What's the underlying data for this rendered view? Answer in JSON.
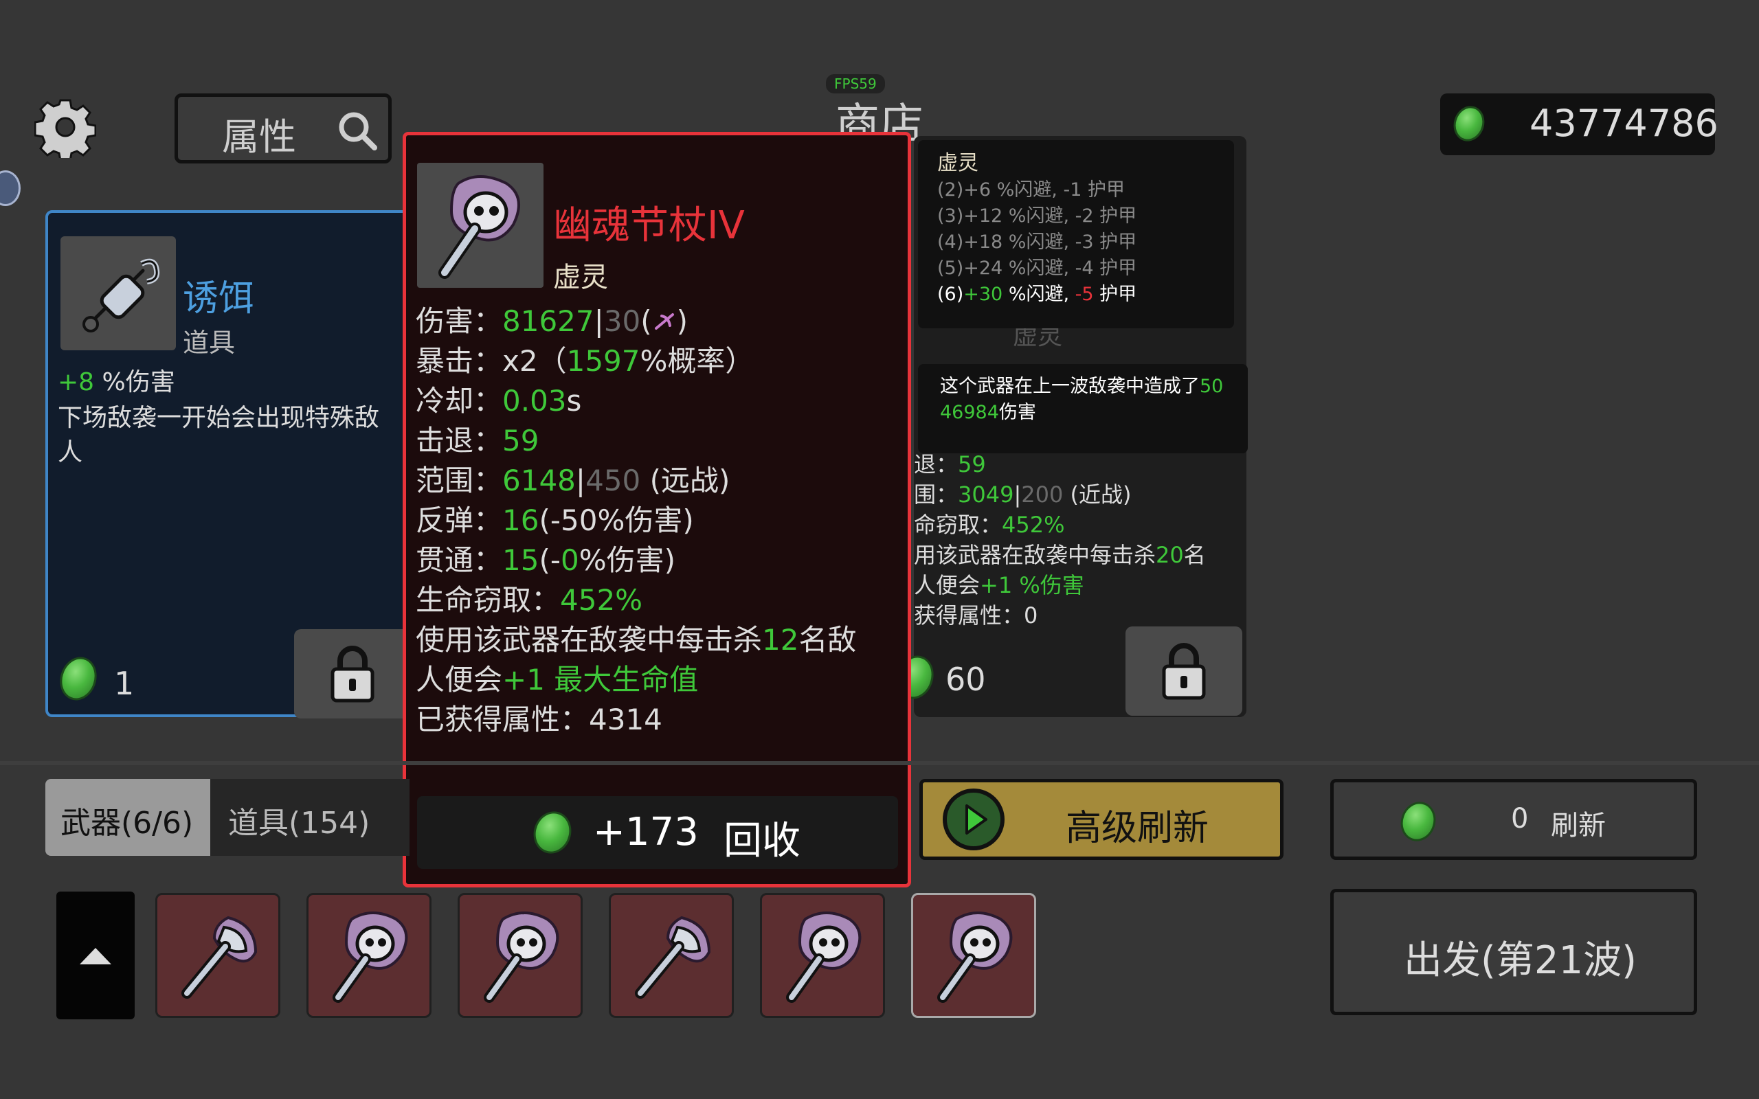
{
  "fps": "FPS59",
  "shop_title": "商店",
  "money": "43774786",
  "attr_button": "属性",
  "left_card": {
    "name": "诱饵",
    "type": "道具",
    "stat_value": "+8",
    "stat_label": "%伤害",
    "desc": "下场敌袭一开始会出现特殊敌人",
    "price": "1"
  },
  "tooltip": {
    "name": "幽魂节杖IV",
    "type": "虚灵",
    "damage_label": "伤害：",
    "damage_value": "81627",
    "damage_base": "30",
    "crit_label": "暴击：",
    "crit_mult": "x2（",
    "crit_value": "1597",
    "crit_suffix": "%概率）",
    "cooldown_label": "冷却：",
    "cooldown_value": "0.03",
    "cooldown_unit": "s",
    "knockback_label": "击退：",
    "knockback_value": "59",
    "range_label": "范围：",
    "range_value": "6148",
    "range_base": "450",
    "range_type": "(远战)",
    "bounce_label": "反弹：",
    "bounce_value": "16",
    "bounce_suffix": "(-50%伤害)",
    "pierce_label": "贯通：",
    "pierce_value": "15",
    "pierce_mid": "(-",
    "pierce_pct": "0",
    "pierce_suffix": "%伤害)",
    "lifesteal_label": "生命窃取：",
    "lifesteal_value": "452%",
    "kill_prefix": "使用该武器在敌袭中每击杀",
    "kill_count": "12",
    "kill_suffix": "名敌",
    "kill_line2_prefix": "人便会",
    "kill_bonus": "+1 最大生命值",
    "gained_label": "已获得属性：",
    "gained_value": "4314",
    "recycle_value": "+173",
    "recycle_label": "回收"
  },
  "set_tooltip": {
    "title": "虚灵",
    "lines": [
      "(2)+6 %闪避, -1 护甲",
      "(3)+12 %闪避, -2 护甲",
      "(4)+18 %闪避, -3 护甲",
      "(5)+24 %闪避, -4 护甲"
    ],
    "active_prefix": "(6)",
    "active_value": "+30",
    "active_mid": "%闪避, ",
    "active_neg": "-5",
    "active_suffix": "护甲"
  },
  "damage_note": {
    "prefix": "这个武器在上一波敌袭中造成了",
    "value_a": "50",
    "value_b": "46984",
    "suffix": "伤害"
  },
  "right_card": {
    "hidden_type": "虚灵",
    "knockback_label": "退：",
    "knockback_value": "59",
    "range_label": "围：",
    "range_value": "3049",
    "range_base": "200",
    "range_type": "(近战)",
    "lifesteal_label": "命窃取：",
    "lifesteal_value": "452%",
    "kill_prefix": "用该武器在敌袭中每击杀",
    "kill_count": "20",
    "kill_suffix": "名",
    "kill_line2": "人便会",
    "kill_bonus": "+1 %伤害",
    "gained_label": "获得属性：",
    "gained_value": "0",
    "price": "60"
  },
  "tabs": {
    "weapons": "武器(6/6)",
    "items": "道具(154)"
  },
  "premium_refresh": "高级刷新",
  "refresh": {
    "cost": "0",
    "label": "刷新"
  },
  "go_button": "出发(第21波)",
  "inventory": [
    {
      "icon": "axe-icon"
    },
    {
      "icon": "ghost-scepter-icon"
    },
    {
      "icon": "ghost-scepter-icon"
    },
    {
      "icon": "axe-icon"
    },
    {
      "icon": "ghost-scepter-icon"
    },
    {
      "icon": "ghost-scepter-icon",
      "selected": true
    }
  ],
  "colors": {
    "tooltip_border": "#e8333a",
    "accent_green": "#3fc83a",
    "refresh_gold": "#a48a3a",
    "card_blue": "#3f86c8"
  }
}
